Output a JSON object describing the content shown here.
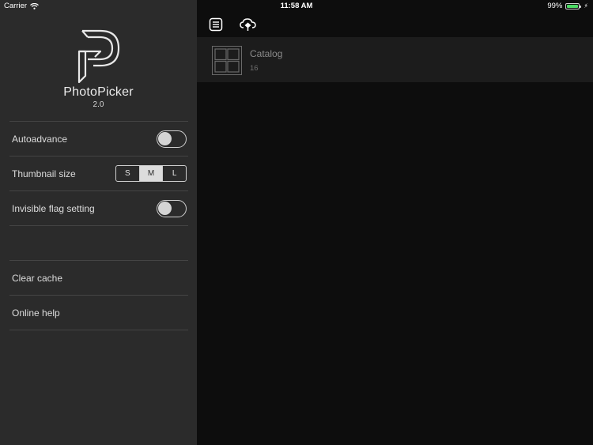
{
  "status": {
    "carrier": "Carrier",
    "time": "11:58 AM",
    "battery": "99%",
    "battery_level": 0.99
  },
  "app": {
    "name": "PhotoPicker",
    "version": "2.0"
  },
  "settings": {
    "autoadvance_label": "Autoadvance",
    "autoadvance_on": false,
    "thumbnail_label": "Thumbnail size",
    "thumbnail_options": [
      "S",
      "M",
      "L"
    ],
    "thumbnail_selected": "M",
    "invisible_flag_label": "Invisible flag setting",
    "invisible_flag_on": false,
    "clear_cache_label": "Clear cache",
    "online_help_label": "Online help"
  },
  "main": {
    "catalog": {
      "title": "Catalog",
      "count": "16"
    }
  },
  "colors": {
    "sidebar_bg": "#2b2b2b",
    "main_bg": "#0d0d0d",
    "catalog_row_bg": "#1c1c1c",
    "battery_green": "#4cd964"
  },
  "icons": {
    "menu": "list-icon",
    "cloud": "cloud-sync-icon",
    "wifi": "wifi-icon"
  }
}
